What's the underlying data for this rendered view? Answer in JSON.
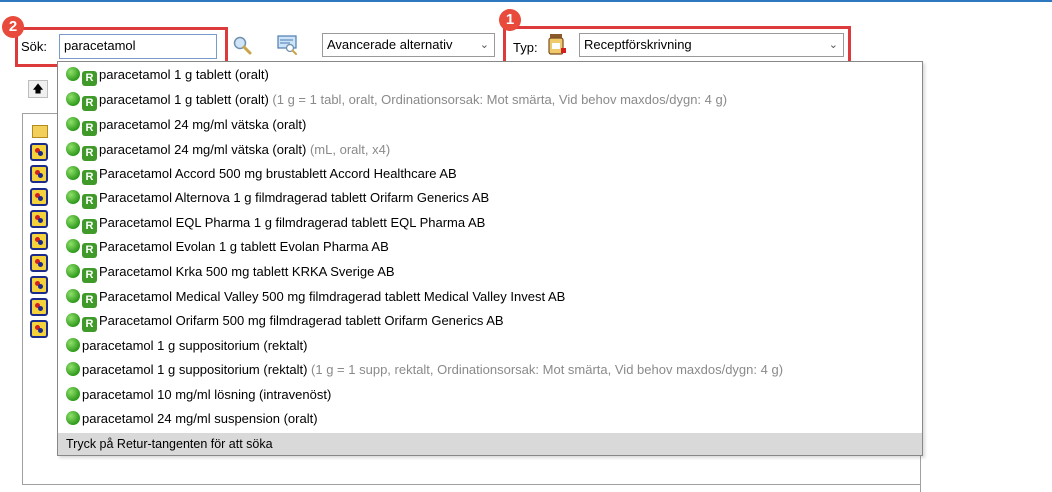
{
  "toolbar": {
    "search_label": "Sök:",
    "search_value": "paracetamol",
    "advanced_option": "Avancerade alternativ",
    "type_label": "Typ:",
    "type_value": "Receptförskrivning"
  },
  "callouts": {
    "one": "1",
    "two": "2"
  },
  "dropdown": {
    "items": [
      {
        "text": "paracetamol 1 g tablett (oralt)",
        "extra": "",
        "rx": true
      },
      {
        "text": "paracetamol 1 g tablett (oralt)",
        "extra": " (1 g = 1 tabl, oralt, Ordinationsorsak: Mot smärta, Vid behov maxdos/dygn: 4 g)",
        "rx": true
      },
      {
        "text": "paracetamol 24 mg/ml vätska (oralt)",
        "extra": "",
        "rx": true
      },
      {
        "text": "paracetamol 24 mg/ml vätska (oralt)",
        "extra": " (mL, oralt, x4)",
        "rx": true
      },
      {
        "text": "Paracetamol Accord 500 mg brustablett Accord Healthcare AB",
        "extra": "",
        "rx": true
      },
      {
        "text": "Paracetamol Alternova 1 g filmdragerad tablett Orifarm Generics AB",
        "extra": "",
        "rx": true
      },
      {
        "text": "Paracetamol EQL Pharma 1 g filmdragerad tablett EQL Pharma AB",
        "extra": "",
        "rx": true
      },
      {
        "text": "Paracetamol Evolan 1 g tablett Evolan Pharma AB",
        "extra": "",
        "rx": true
      },
      {
        "text": "Paracetamol Krka 500 mg tablett KRKA Sverige AB",
        "extra": "",
        "rx": true
      },
      {
        "text": "Paracetamol Medical Valley 500 mg filmdragerad tablett Medical Valley Invest AB",
        "extra": "",
        "rx": true
      },
      {
        "text": "Paracetamol Orifarm 500 mg filmdragerad tablett Orifarm Generics AB",
        "extra": "",
        "rx": true
      },
      {
        "text": "paracetamol 1 g suppositorium (rektalt)",
        "extra": "",
        "rx": false
      },
      {
        "text": "paracetamol 1 g suppositorium (rektalt)",
        "extra": " (1 g = 1 supp, rektalt, Ordinationsorsak: Mot smärta, Vid behov maxdos/dygn: 4 g)",
        "rx": false
      },
      {
        "text": "paracetamol 10 mg/ml lösning (intravenöst)",
        "extra": "",
        "rx": false
      },
      {
        "text": "paracetamol 24 mg/ml suspension (oralt)",
        "extra": "",
        "rx": false
      }
    ],
    "rx_glyph": "R",
    "footer": "Tryck på Retur-tangenten för att söka"
  },
  "colors": {
    "callout": "#dd3b3b",
    "accent": "#2e78c0",
    "status_green": "#3f9a2a"
  },
  "icons": {
    "search": "magnifier-icon",
    "search_advanced": "search-list-icon",
    "type": "prescription-bottle-icon",
    "up": "up-arrow-icon",
    "folder": "folder-icon",
    "tree_node": "medication-node-icon"
  }
}
